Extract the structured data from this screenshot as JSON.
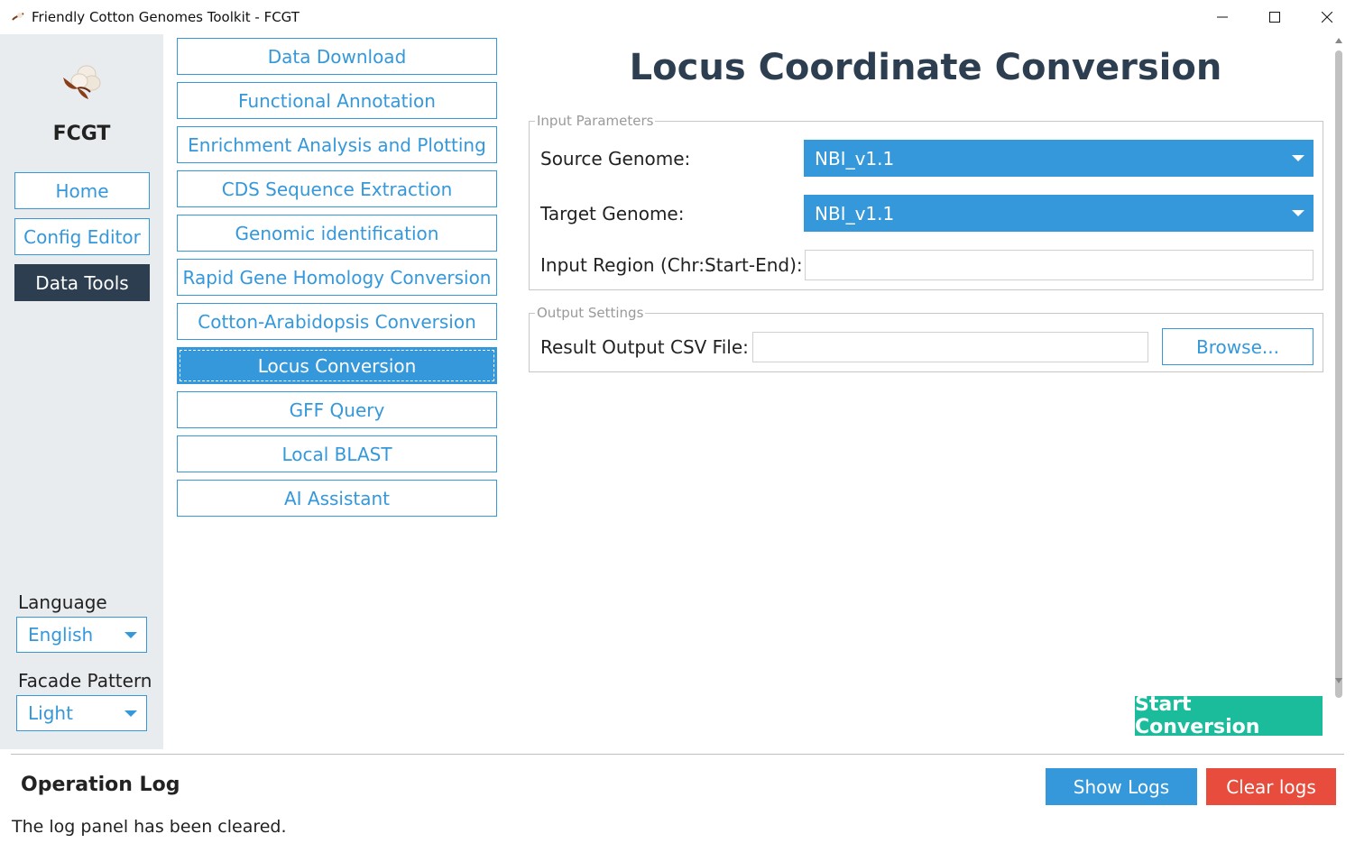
{
  "window": {
    "title": "Friendly Cotton Genomes Toolkit - FCGT"
  },
  "sidebar": {
    "brand": "FCGT",
    "nav": [
      {
        "label": "Home"
      },
      {
        "label": "Config Editor"
      },
      {
        "label": "Data Tools",
        "active": true
      }
    ],
    "language_label": "Language",
    "language_value": "English",
    "facade_label": "Facade Pattern",
    "facade_value": "Light"
  },
  "tools": [
    {
      "label": "Data Download"
    },
    {
      "label": "Functional Annotation"
    },
    {
      "label": "Enrichment Analysis and Plotting"
    },
    {
      "label": "CDS Sequence Extraction"
    },
    {
      "label": "Genomic identification"
    },
    {
      "label": "Rapid Gene Homology Conversion"
    },
    {
      "label": "Cotton-Arabidopsis Conversion"
    },
    {
      "label": "Locus Conversion",
      "active": true
    },
    {
      "label": "GFF Query"
    },
    {
      "label": "Local BLAST"
    },
    {
      "label": "AI Assistant"
    }
  ],
  "main": {
    "title": "Locus Coordinate Conversion",
    "input_group": {
      "legend": "Input Parameters",
      "source_label": "Source Genome:",
      "source_value": "NBI_v1.1",
      "target_label": "Target Genome:",
      "target_value": "NBI_v1.1",
      "region_label": "Input Region (Chr:Start-End):",
      "region_value": ""
    },
    "output_group": {
      "legend": "Output Settings",
      "csv_label": "Result Output CSV File:",
      "csv_value": "",
      "browse_label": "Browse..."
    },
    "start_label": "Start Conversion"
  },
  "log": {
    "title": "Operation Log",
    "show_label": "Show Logs",
    "clear_label": "Clear logs",
    "message": "The log panel has been cleared."
  },
  "colors": {
    "accent": "#3498db",
    "dark": "#2c3e50",
    "success": "#1abc9c",
    "danger": "#e74c3c",
    "sidebar_bg": "#e8ecee"
  }
}
